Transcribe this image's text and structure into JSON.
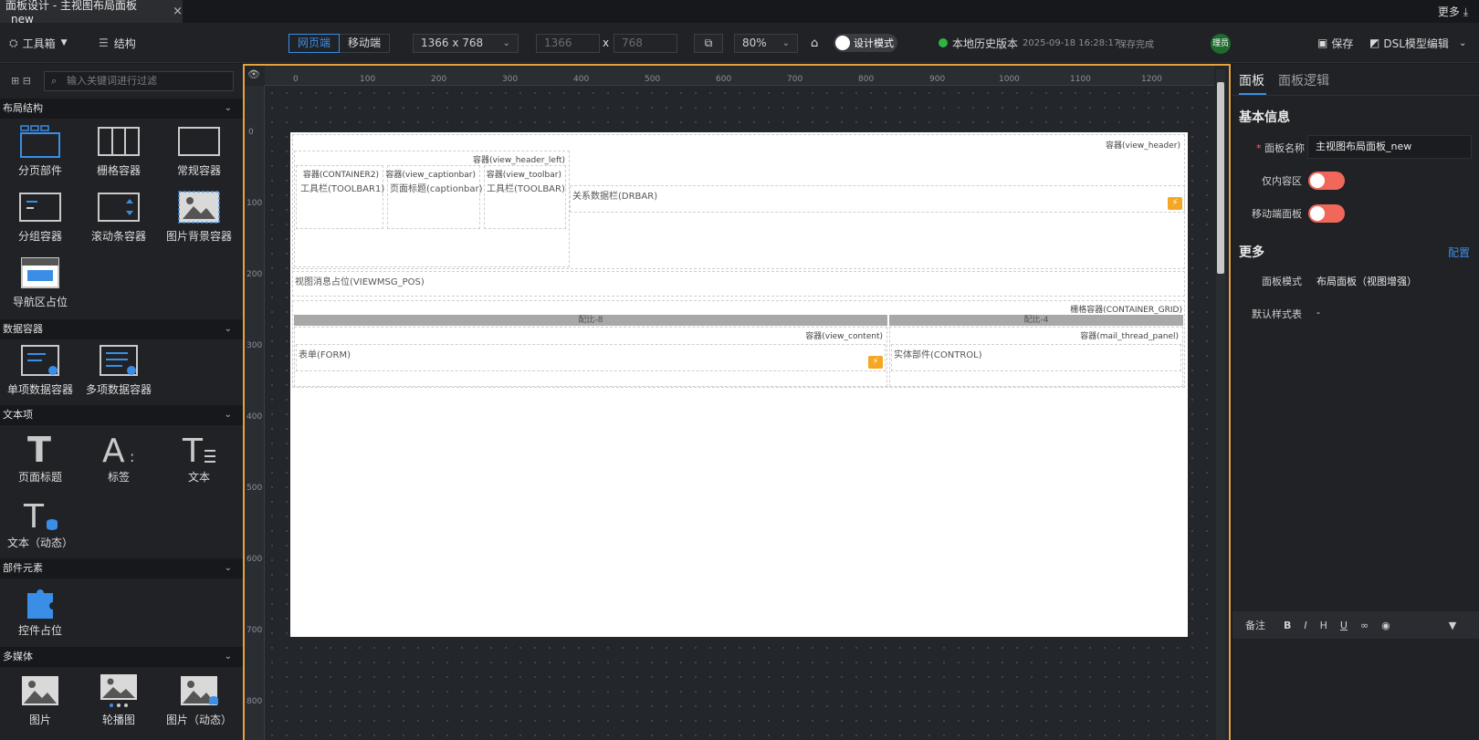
{
  "tab": {
    "title": "面板设计 - 主视图布局面板_new",
    "close": "×"
  },
  "top_more": "更多",
  "toolbar": {
    "toolbox": "工具箱",
    "structure": "结构",
    "web": "网页端",
    "mobile": "移动端",
    "resolution": "1366 x 768",
    "width": "1366",
    "x_sep": "x",
    "height": "768",
    "zoom": "80%",
    "design_mode": "设计模式",
    "history": "本地历史版本",
    "timestamp": "2025-09-18 16:28:17",
    "save_status": "保存完成",
    "avatar": "理员",
    "save": "保存",
    "dsl": "DSL模型编辑"
  },
  "left": {
    "search_placeholder": "输入关键词进行过滤",
    "sections": {
      "layout": "布局结构",
      "data": "数据容器",
      "text": "文本项",
      "part": "部件元素",
      "media": "多媒体"
    },
    "layout_items": [
      "分页部件",
      "栅格容器",
      "常规容器",
      "分组容器",
      "滚动条容器",
      "图片背景容器",
      "导航区占位"
    ],
    "data_items": [
      "单项数据容器",
      "多项数据容器"
    ],
    "text_items": [
      "页面标题",
      "标签",
      "文本",
      "文本（动态）"
    ],
    "part_items": [
      "控件占位"
    ],
    "media_items": [
      "图片",
      "轮播图",
      "图片（动态）"
    ]
  },
  "ruler": {
    "h": [
      "0",
      "100",
      "200",
      "300",
      "400",
      "500",
      "600",
      "700",
      "800",
      "900",
      "1000",
      "1100",
      "1200"
    ],
    "v": [
      "0",
      "100",
      "200",
      "300",
      "400",
      "500",
      "600",
      "700",
      "800"
    ]
  },
  "canvas": {
    "view_header": "容器(view_header)",
    "view_header_left": "容器(view_header_left)",
    "container2": "容器(CONTAINER2)",
    "captionbar_c": "容器(view_captionbar)",
    "toolbar_c": "容器(view_toolbar)",
    "toolbar1": "工具栏(TOOLBAR1)",
    "captionbar": "页面标题(captionbar)",
    "toolbar": "工具栏(TOOLBAR)",
    "drbar": "关系数据栏(DRBAR)",
    "viewmsg": "视图消息占位(VIEWMSG_POS)",
    "container_grid": "栅格容器(CONTAINER_GRID)",
    "ratio8": "配比-8",
    "ratio4": "配比-4",
    "view_content": "容器(view_content)",
    "mail_thread": "容器(mail_thread_panel)",
    "form": "表单(FORM)",
    "control": "实体部件(CONTROL)"
  },
  "right": {
    "tab_panel": "面板",
    "tab_logic": "面板逻辑",
    "basic_info": "基本信息",
    "name_label": "面板名称",
    "name_value": "主视图布局面板_new",
    "inner_only": "仅内容区",
    "mobile_panel": "移动端面板",
    "more": "更多",
    "config": "配置",
    "mode_label": "面板模式",
    "mode_value": "布局面板（视图增强）",
    "style_label": "默认样式表",
    "style_value": "-",
    "note": "备注"
  }
}
